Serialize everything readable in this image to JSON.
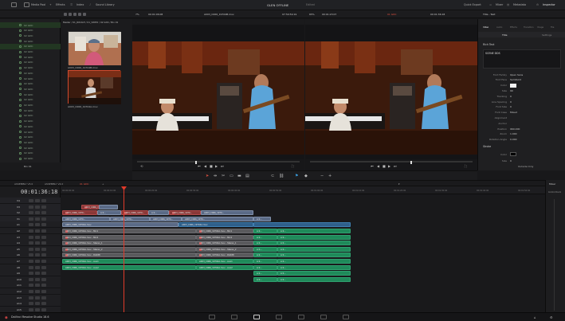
{
  "topbar": {
    "media_pool": "Media Pool",
    "effects": "Effects",
    "index": "Index",
    "sound_library": "Sound Library",
    "project_title": "GLEN OFFLINE",
    "project_status": "Edited",
    "quick_export": "Quick Export",
    "mixer": "Mixer",
    "metadata": "Metadata",
    "inspector": "Inspector"
  },
  "bar2": {
    "zoom_left": "7%",
    "src_timecode": "00:01:06:08",
    "clip_name": "A003_C066_19704B.mov",
    "src_duration": "07:59:59:19",
    "zoom_right": "65%",
    "rec_timecode": "00:01:23:07",
    "timeline_name": "01 GDC",
    "rec_duration": "00:01:36:18",
    "inspector_title": "Title - Text"
  },
  "bins": {
    "items": [
      "02 GDC",
      "02 GDC",
      "02 GDC",
      "02 GDC",
      "02 GDC",
      "02 GDC",
      "02 GDC",
      "02 GDC",
      "02 GDC",
      "02 GDC",
      "02 GDC",
      "02 GDC",
      "02 GDC",
      "02 GDC",
      "02 GDC",
      "02 GDC",
      "02 GDC",
      "02 GDC",
      "02 GDC",
      "02 GDC",
      "02 GDC",
      "02 GDC",
      "02 GDC",
      "02 GDC",
      "02 GDC",
      "02 GDC"
    ],
    "footer": "Bin 01"
  },
  "thumbs": {
    "path": "Master / 01_ROUGH / 01_VIDEO / 02 GDC / Bin 01",
    "items": [
      {
        "caption": "A003_C066_19704B.mov"
      },
      {
        "caption": "A003_C066_19704A.mov"
      }
    ]
  },
  "inspector": {
    "tabs": [
      "Video",
      "Audio",
      "Effects",
      "Transition",
      "Image",
      "File"
    ],
    "subtabs": [
      "Title",
      "Settings"
    ],
    "section_title": "Rich Text",
    "text_value": "SCENE DDS",
    "rows": [
      {
        "k": "Font Family",
        "v": "Open Sans"
      },
      {
        "k": "Font Face",
        "v": "Semibold"
      },
      {
        "k": "Color",
        "v": ""
      },
      {
        "k": "Size",
        "v": "90"
      },
      {
        "k": "Tracking",
        "v": "0"
      },
      {
        "k": "Line Spacing",
        "v": "0"
      },
      {
        "k": "Font Size",
        "v": "0"
      },
      {
        "k": "Font Case",
        "v": "Mixed"
      },
      {
        "k": "Alignment",
        "v": ""
      },
      {
        "k": "Anchor",
        "v": ""
      },
      {
        "k": "Position",
        "v": "960.000"
      },
      {
        "k": "Zoom",
        "v": "1.000"
      },
      {
        "k": "Rotation Angle",
        "v": "0.000"
      }
    ],
    "stroke_section": "Stroke",
    "stroke_rows": [
      {
        "k": "Color",
        "v": ""
      },
      {
        "k": "Size",
        "v": "0"
      }
    ],
    "outside_only": "Outside Only"
  },
  "tabs": [
    {
      "label": "ASSEMBLY V3.0"
    },
    {
      "label": "ASSEMBLY V4.0"
    },
    {
      "label": "01 GDC"
    }
  ],
  "timeline": {
    "timecode": "00:01:36:18",
    "tracks": [
      {
        "name": "V4"
      },
      {
        "name": "V3"
      },
      {
        "name": "V2"
      },
      {
        "name": "V1"
      },
      {
        "name": "A1"
      },
      {
        "name": "A2"
      },
      {
        "name": "A3"
      },
      {
        "name": "A4"
      },
      {
        "name": "A5"
      },
      {
        "name": "A6"
      },
      {
        "name": "A7"
      },
      {
        "name": "A8"
      },
      {
        "name": "A9"
      },
      {
        "name": "A10"
      },
      {
        "name": "A11"
      },
      {
        "name": "A12"
      },
      {
        "name": "A13"
      },
      {
        "name": "A14"
      },
      {
        "name": "A15"
      }
    ],
    "ruler": [
      "00:00:00:00",
      "00:00:10:00",
      "00:00:20:00",
      "00:00:30:00",
      "00:00:40:00",
      "00:00:50:00",
      "00:01:00:00",
      "00:01:10:00",
      "00:01:20:00",
      "00:01:30:00",
      "00:01:40:00",
      "00:01:50:00",
      "00:02:00:00"
    ],
    "clip_v1": "A003_C066_19704A.mov",
    "clip_v1b": "A003_C066_19704A.mov",
    "clip_v2": "A003_C066_1970...",
    "clip_v3": "A003_C066_1970...",
    "clip_v4": "A003_C066_1970...",
    "audio_a1": "A003_C066_19704A.mov - Mic1",
    "audio_a2": "A003_C066_19704A.mov - Mic2",
    "audio_a3": "A003_C066_19704A.mov - Stereo_1",
    "audio_a4": "A003_C066_19704A.mov - Stereo_2",
    "audio_a5": "A003_C066_19704A.mov - DLR88",
    "audio_a6": "A003_C066_19704A.mov - Aux1",
    "audio_a7": "A003_C066_19704A.mov - Aux2",
    "short": "A 0..."
  },
  "mixer": {
    "title": "Mixer",
    "label": "Control Room"
  },
  "bottombar": {
    "app": "DaVinci Resolve Studio 18.6"
  },
  "colors": {
    "accent_red": "#e03a2a",
    "clip_green": "#1f8a5a",
    "clip_blue": "#2f5f8a"
  }
}
